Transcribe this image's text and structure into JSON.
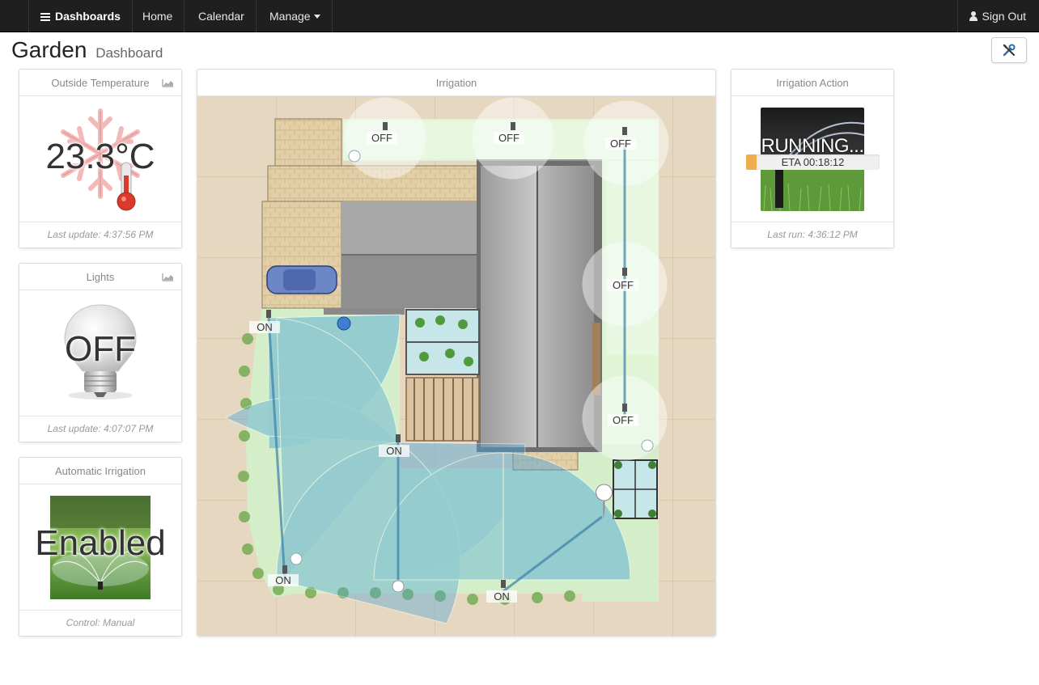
{
  "nav": {
    "brand": "Dashboards",
    "home": "Home",
    "calendar": "Calendar",
    "manage": "Manage",
    "signout": "Sign Out"
  },
  "page": {
    "title": "Garden",
    "subtitle": "Dashboard"
  },
  "widgets": {
    "temperature": {
      "title": "Outside Temperature",
      "value": "23.3°C",
      "footer": "Last update: 4:37:56 PM",
      "icon": "snowflake-thermometer-icon"
    },
    "lights": {
      "title": "Lights",
      "value": "OFF",
      "footer": "Last update: 4:07:07 PM",
      "icon": "lightbulb-icon"
    },
    "auto_irrigation": {
      "title": "Automatic Irrigation",
      "value": "Enabled",
      "footer": "Control: Manual",
      "icon": "sprinkler-image"
    },
    "irrigation": {
      "title": "Irrigation",
      "zones": {
        "z1": "OFF",
        "z2": "OFF",
        "z3": "OFF",
        "z4": "OFF",
        "z5": "OFF",
        "z6": "ON",
        "z7": "ON",
        "z8": "ON",
        "z9": "ON"
      }
    },
    "irrigation_action": {
      "title": "Irrigation Action",
      "status": "RUNNING...",
      "eta": "ETA 00:18:12",
      "progress_fraction": 0.08,
      "footer": "Last run: 4:36:12 PM",
      "icon": "sprinkler-image"
    }
  },
  "colors": {
    "navbar": "#1f1f1f",
    "water": "#4aa3d8",
    "lawn": "#cdebc3",
    "ground": "#e3d5bd",
    "progress": "#f0ad4e"
  }
}
